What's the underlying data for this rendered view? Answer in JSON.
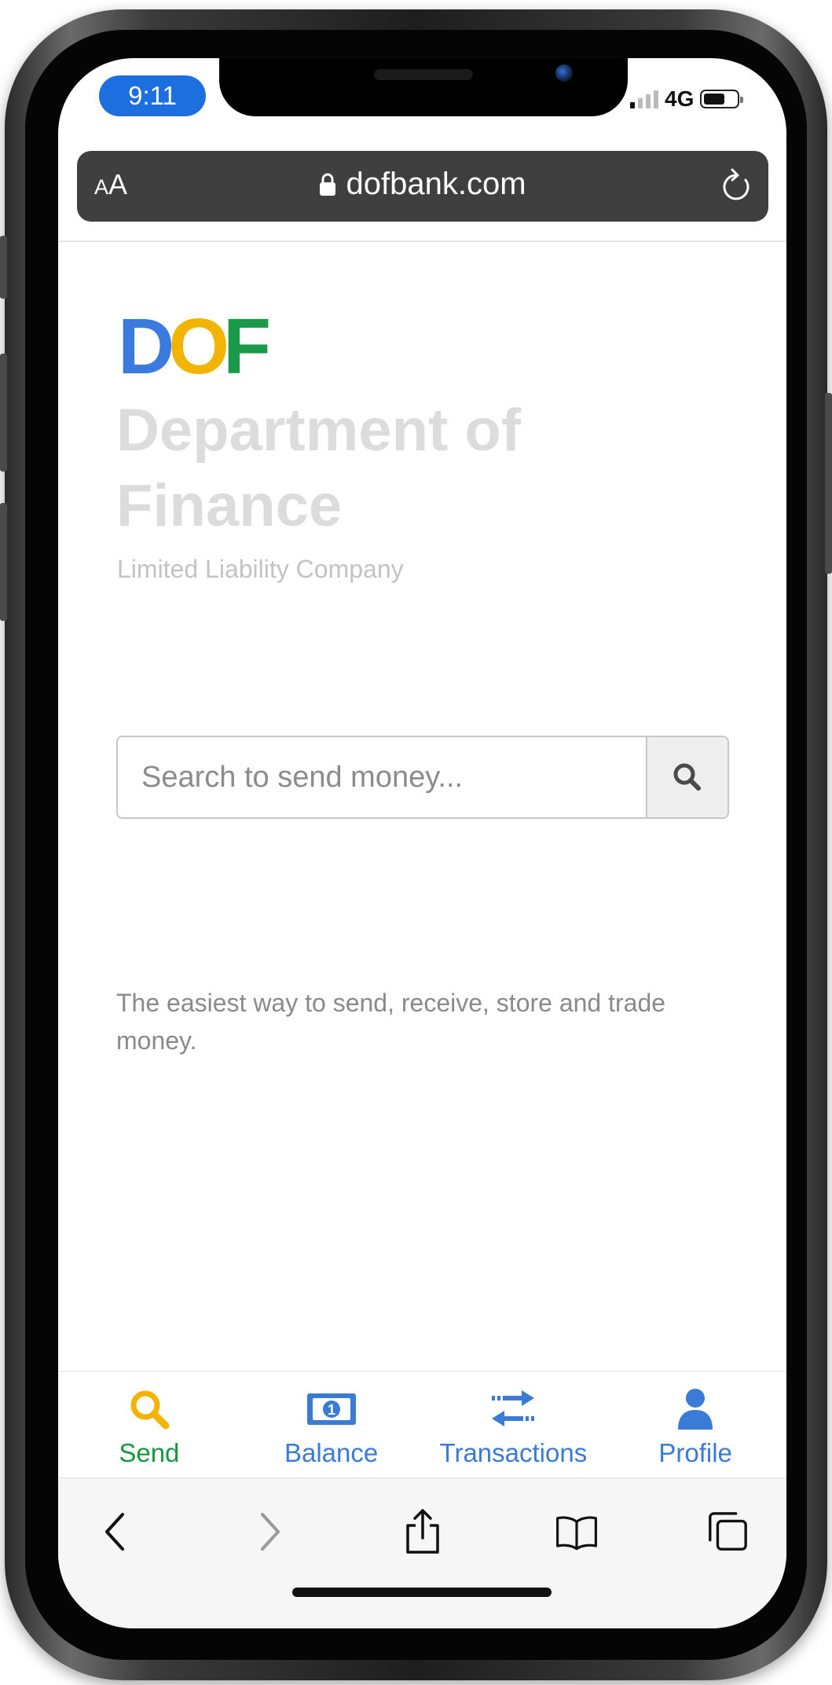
{
  "status_bar": {
    "time": "9:11",
    "network": "4G"
  },
  "browser": {
    "text_size_label": "A",
    "text_size_label_small": "A",
    "url": "dofbank.com"
  },
  "brand": {
    "logo_letters": [
      "D",
      "O",
      "F"
    ],
    "logo_colors": [
      "#3b7be0",
      "#f2b400",
      "#1a9a48"
    ],
    "title": "Department of Finance",
    "subtitle": "Limited Liability Company"
  },
  "search": {
    "placeholder": "Search to send money..."
  },
  "tagline": "The easiest way to send, receive, store and trade money.",
  "bottom_nav": {
    "items": [
      {
        "label": "Send",
        "icon": "search-icon",
        "active": true
      },
      {
        "label": "Balance",
        "icon": "banknote-icon",
        "active": false
      },
      {
        "label": "Transactions",
        "icon": "transfer-arrows-icon",
        "active": false
      },
      {
        "label": "Profile",
        "icon": "user-icon",
        "active": false
      }
    ],
    "active_color": "#14993f",
    "inactive_color": "#3a7bd5"
  },
  "safari_toolbar": {
    "icons": [
      "back-icon",
      "forward-icon",
      "share-icon",
      "bookmarks-icon",
      "tabs-icon"
    ]
  }
}
